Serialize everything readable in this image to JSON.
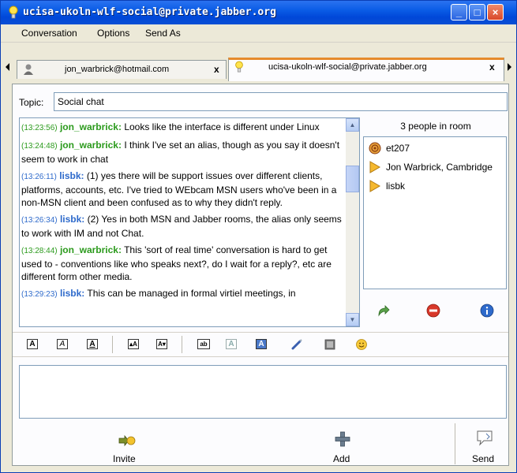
{
  "window": {
    "title": "ucisa-ukoln-wlf-social@private.jabber.org",
    "minimize": "_",
    "maximize": "□",
    "close": "×"
  },
  "menu": [
    "Conversation",
    "Options",
    "Send As"
  ],
  "tabs": [
    {
      "label": "jon_warbrick@hotmail.com",
      "close": "x",
      "icon": "contact-icon"
    },
    {
      "label": "ucisa-ukoln-wlf-social@private.jabber.org",
      "close": "x",
      "icon": "lightbulb-icon",
      "active": true
    }
  ],
  "topic": {
    "label": "Topic:",
    "value": "Social chat"
  },
  "messages": [
    {
      "time": "(13:23:56)",
      "nick": "jon_warbrick:",
      "text": "Looks like the interface is different under Linux",
      "color": "#2b9a1c"
    },
    {
      "time": "(13:24:48)",
      "nick": "jon_warbrick:",
      "text": "I think I've set an alias, though as you say it doesn't seem to work in chat",
      "color": "#2b9a1c"
    },
    {
      "time": "(13:26:11)",
      "nick": "lisbk:",
      "text": "(1) yes there will be support issues over different clients, platforms, accounts, etc.  I've tried to WEbcam MSN users who've been in a non-MSN client and been confused as to why they didn't reply.",
      "color": "#2e6acb"
    },
    {
      "time": "(13:26:34)",
      "nick": "lisbk:",
      "text": "(2) Yes in both MSN and Jabber rooms, the alias only seems to work with IM and not Chat.",
      "color": "#2e6acb"
    },
    {
      "time": "(13:28:44)",
      "nick": "jon_warbrick:",
      "text": "This 'sort of real time' conversation is hard to get used to - conventions like who speaks next?, do I wait for a reply?, etc are different form other media.",
      "color": "#2b9a1c"
    },
    {
      "time": "(13:29:23)",
      "nick": "lisbk:",
      "text": "This can be managed in formal virtiel meetings, in",
      "color": "#2e6acb"
    }
  ],
  "room": {
    "count_label": "3 people in room",
    "people": [
      {
        "name": "et207",
        "icon": "spiral-icon"
      },
      {
        "name": "Jon Warbrick, Cambridge",
        "icon": "triangle-icon"
      },
      {
        "name": "lisbk",
        "icon": "triangle-icon"
      }
    ]
  },
  "bottom": {
    "invite": "Invite",
    "add": "Add",
    "send": "Send"
  }
}
